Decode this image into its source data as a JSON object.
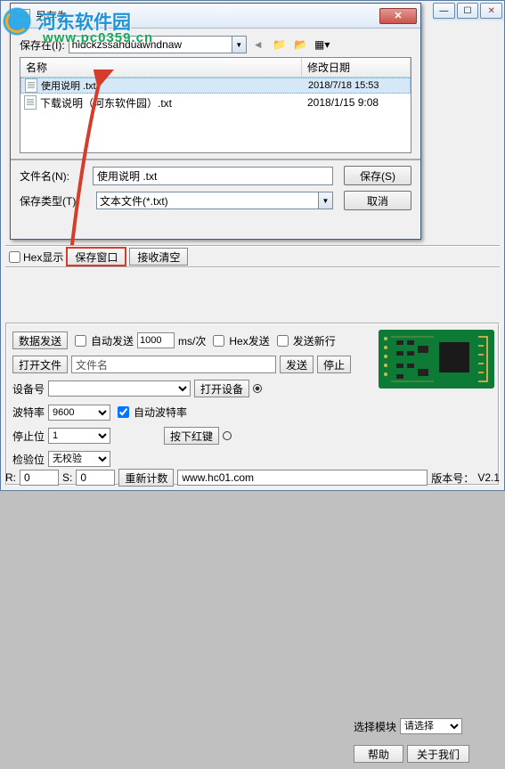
{
  "watermark": {
    "brand": "河东软件园",
    "url": "www.pc0359.cn"
  },
  "dialog": {
    "title": "另存为",
    "icon_text": "HID",
    "save_in_label": "保存在(I):",
    "save_in_value": "hidckzssahduawndnaw",
    "columns": {
      "name": "名称",
      "modified": "修改日期"
    },
    "files": [
      {
        "name": "使用说明 .txt",
        "modified": "2018/7/18 15:53",
        "selected": true
      },
      {
        "name": "下载说明（河东软件园）.txt",
        "modified": "2018/1/15 9:08",
        "selected": false
      }
    ],
    "filename_label": "文件名(N):",
    "filename_value": "使用说明 .txt",
    "filetype_label": "保存类型(T):",
    "filetype_value": "文本文件(*.txt)",
    "save_btn": "保存(S)",
    "cancel_btn": "取消"
  },
  "mid": {
    "hex_display": "Hex显示",
    "save_window": "保存窗口",
    "clear_recv": "接收清空"
  },
  "lower": {
    "data_send": "数据发送",
    "auto_send": "自动发送",
    "auto_interval": "1000",
    "interval_unit": "ms/次",
    "hex_send": "Hex发送",
    "send_newline": "发送新行",
    "open_file": "打开文件",
    "filename_placeholder": "文件名",
    "send": "发送",
    "stop": "停止",
    "device_no": "设备号",
    "open_device": "打开设备",
    "baud": "波特率",
    "baud_val": "9600",
    "auto_baud": "自动波特率",
    "stopbit": "停止位",
    "stopbit_val": "1",
    "press_red": "按下红键",
    "checkbit": "检验位",
    "checkbit_val": "无校验",
    "select_module": "选择模块",
    "select_module_val": "请选择",
    "help": "帮助",
    "about": "关于我们",
    "r_label": "R:",
    "r_val": "0",
    "s_label": "S:",
    "s_val": "0",
    "reset_count": "重新计数",
    "url": "www.hc01.com",
    "version_label": "版本号：",
    "version_val": "V2.1"
  }
}
